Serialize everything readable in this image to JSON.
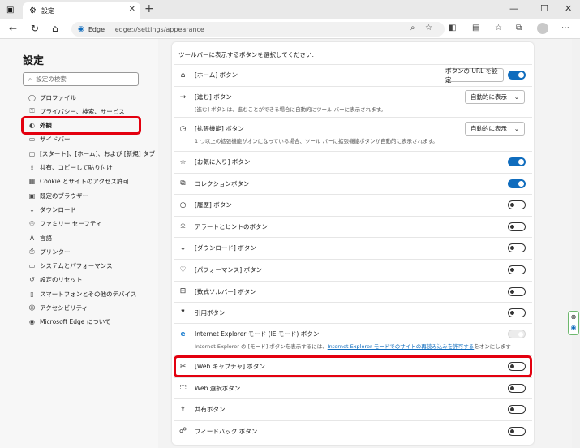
{
  "browser": {
    "tab_title": "設定",
    "new_tab": "+",
    "window_controls": {
      "minimize": "—",
      "maximize": "☐",
      "close": "✕"
    },
    "address_brand": "Edge",
    "address_url": "edge://settings/appearance"
  },
  "sidebar": {
    "title": "設定",
    "search_placeholder": "設定の検索",
    "items": [
      {
        "label": "プロファイル",
        "icon": "profile-icon",
        "glyph": "◯"
      },
      {
        "label": "プライバシー、検索、サービス",
        "icon": "lock-icon",
        "glyph": "⚿"
      },
      {
        "label": "外観",
        "icon": "palette-icon",
        "glyph": "◐"
      },
      {
        "label": "サイドバー",
        "icon": "sidebar-icon",
        "glyph": "▭"
      },
      {
        "label": "[スタート]、[ホーム]、および [新規] タブ",
        "icon": "tabs-icon",
        "glyph": "▢"
      },
      {
        "label": "共有、コピーして貼り付け",
        "icon": "share-icon",
        "glyph": "⇪"
      },
      {
        "label": "Cookie とサイトのアクセス許可",
        "icon": "cookie-icon",
        "glyph": "▦"
      },
      {
        "label": "既定のブラウザー",
        "icon": "browser-icon",
        "glyph": "▣"
      },
      {
        "label": "ダウンロード",
        "icon": "download-icon",
        "glyph": "↓"
      },
      {
        "label": "ファミリー セーフティ",
        "icon": "family-icon",
        "glyph": "⚇"
      },
      {
        "label": "言語",
        "icon": "language-icon",
        "glyph": "A"
      },
      {
        "label": "プリンター",
        "icon": "printer-icon",
        "glyph": "⎙"
      },
      {
        "label": "システムとパフォーマンス",
        "icon": "system-icon",
        "glyph": "▭"
      },
      {
        "label": "設定のリセット",
        "icon": "reset-icon",
        "glyph": "↺"
      },
      {
        "label": "スマートフォンとその他のデバイス",
        "icon": "phone-icon",
        "glyph": "▯"
      },
      {
        "label": "アクセシビリティ",
        "icon": "accessibility-icon",
        "glyph": "☺"
      },
      {
        "label": "Microsoft Edge について",
        "icon": "edge-icon",
        "glyph": "◉"
      }
    ]
  },
  "main": {
    "heading": "ツールバーに表示するボタンを選択してください:",
    "home": {
      "label": "[ホーム] ボタン",
      "button": "ボタンの URL を設定",
      "on": true
    },
    "forward": {
      "label": "[進む] ボタン",
      "desc": "[進む] ボタンは、進むことができる場合に自動的にツール バーに表示されます。",
      "dropdown": "自動的に表示"
    },
    "extensions": {
      "label": "[拡張機能] ボタン",
      "desc": "1 つ以上の拡張機能がオンになっている場合、ツール バーに拡張機能ボタンが自動的に表示されます。",
      "dropdown": "自動的に表示"
    },
    "toggles": [
      {
        "label": "[お気に入り] ボタン",
        "on": true,
        "icon": "favorites-icon",
        "glyph": "☆"
      },
      {
        "label": "コレクションボタン",
        "on": true,
        "icon": "collections-icon",
        "glyph": "⧉"
      },
      {
        "label": "[履歴] ボタン",
        "on": false,
        "icon": "history-icon",
        "glyph": "◷"
      },
      {
        "label": "アラートとヒントのボタン",
        "on": false,
        "icon": "bell-icon",
        "glyph": "⍾"
      },
      {
        "label": "[ダウンロード] ボタン",
        "on": false,
        "icon": "download-icon",
        "glyph": "↓"
      },
      {
        "label": "[パフォーマンス] ボタン",
        "on": false,
        "icon": "heart-pulse-icon",
        "glyph": "♡"
      },
      {
        "label": "[数式ソルバー] ボタン",
        "on": false,
        "icon": "math-icon",
        "glyph": "⊞"
      },
      {
        "label": "引用ボタン",
        "on": false,
        "icon": "quote-icon",
        "glyph": "❞"
      }
    ],
    "ie": {
      "label": "Internet Explorer モード (IE モード) ボタン",
      "desc_pre": "Internet Explorer の [モード] ボタンを表示するには、",
      "desc_link": "Internet Explorer モードでのサイトの再読み込みを許可する",
      "desc_post": "をオンにします"
    },
    "toggles2": [
      {
        "label": "[Web キャプチャ] ボタン",
        "on": false,
        "icon": "web-capture-icon",
        "glyph": "✂"
      },
      {
        "label": "Web 選択ボタン",
        "on": false,
        "icon": "web-select-icon",
        "glyph": "⬚"
      },
      {
        "label": "共有ボタン",
        "on": false,
        "icon": "share-icon",
        "glyph": "⇪"
      },
      {
        "label": "フィードバック ボタン",
        "on": false,
        "icon": "feedback-icon",
        "glyph": "☍"
      }
    ]
  },
  "colors": {
    "accent": "#0f6cbd",
    "highlight": "#e3000f"
  }
}
